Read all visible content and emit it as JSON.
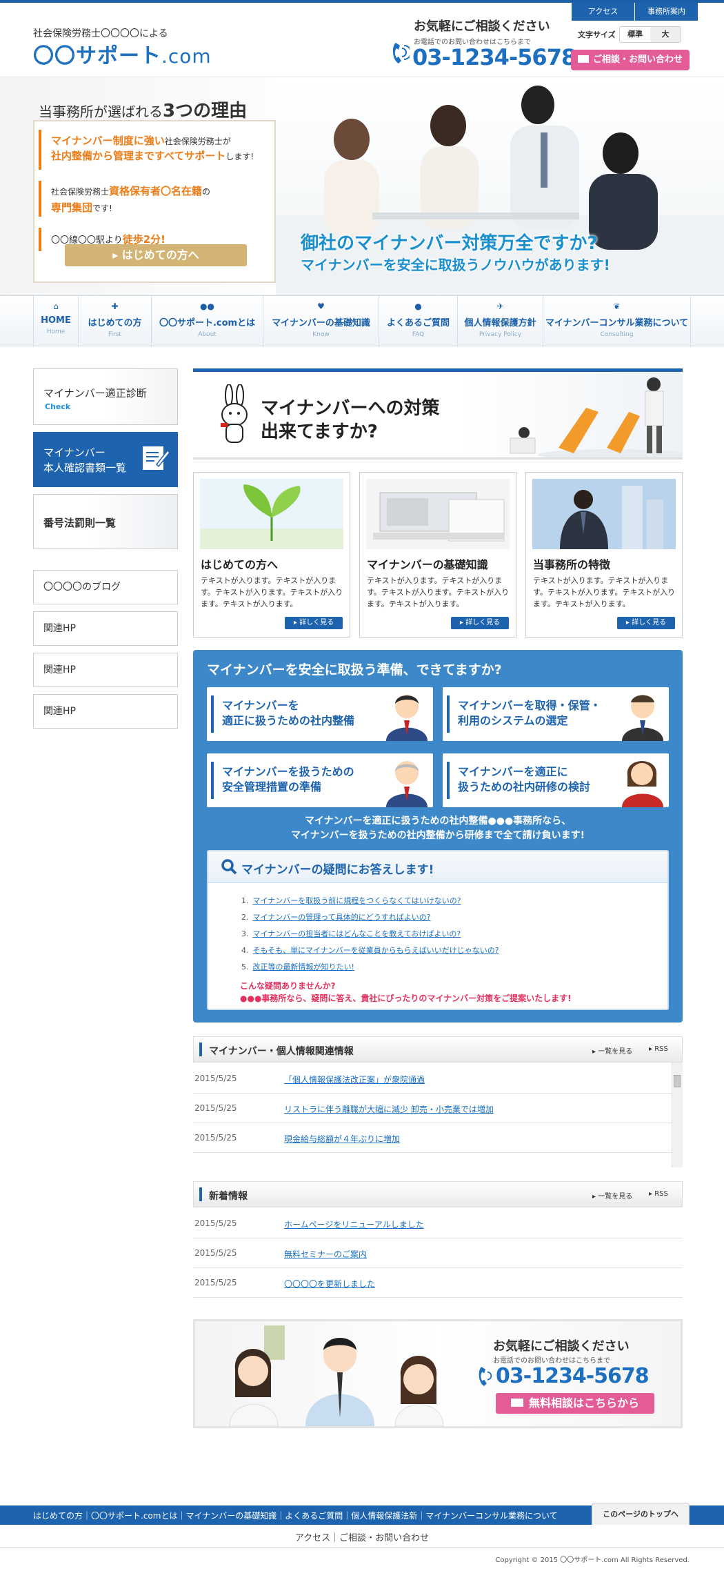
{
  "header": {
    "logo_sub": "社会保険労務士〇〇〇〇による",
    "logo_main": "〇〇サポート",
    "logo_com": ".com",
    "tel_label": "お気軽にご相談ください",
    "tel_sub": "お電話でのお問い合わせはこちらまで",
    "tel_number": "03-1234-5678",
    "top_links": [
      "アクセス",
      "事務所案内"
    ],
    "font_size_label": "文字サイズ",
    "font_size_options": [
      "標準",
      "大"
    ],
    "consult_button": "ご相談・お問い合わせ"
  },
  "hero": {
    "title_pre": "当事務所が選ばれる",
    "title_strong": "3つの理由",
    "reason1_a": "マイナンバー制度に強い",
    "reason1_b": "社会保険労務士が",
    "reason1_c": "社内整備から管理まですべてサポート",
    "reason1_d": "します!",
    "reason2_a": "社会保険労務士",
    "reason2_b": "資格保有者〇名在籍",
    "reason2_c": "の",
    "reason2_d": "専門集団",
    "reason2_e": "です!",
    "reason3_a": "〇〇線〇〇駅より",
    "reason3_b": "徒歩2分!",
    "first_button": "はじめての方へ",
    "catch1": "御社のマイナンバー対策万全ですか?",
    "catch2": "マイナンバーを安全に取扱うノウハウがあります!"
  },
  "nav": [
    {
      "jp": "HOME",
      "en": "Home",
      "icon": "home-icon"
    },
    {
      "jp": "はじめての方",
      "en": "First",
      "icon": "sparkle-icon"
    },
    {
      "jp": "〇〇サポート.comとは",
      "en": "About",
      "icon": "people-icon"
    },
    {
      "jp": "マイナンバーの基礎知識",
      "en": "Know",
      "icon": "heart-icon"
    },
    {
      "jp": "よくあるご質問",
      "en": "FAQ",
      "icon": "speech-icon"
    },
    {
      "jp": "個人情報保護方針",
      "en": "Privacy Policy",
      "icon": "bird-icon"
    },
    {
      "jp": "マイナンバーコンサル業務について",
      "en": "Consulting",
      "icon": "leaf-icon"
    }
  ],
  "sidebar": {
    "banner1_title": "マイナンバー適正診断",
    "banner1_sub": "Check",
    "banner2_line1": "マイナンバー",
    "banner2_line2": "本人確認書類一覧",
    "banner3_title": "番号法罰則一覧",
    "links": [
      "〇〇〇〇のブログ",
      "関連HP",
      "関連HP",
      "関連HP"
    ]
  },
  "main_banner": {
    "line1": "マイナンバーへの対策",
    "line2": "出来てますか?"
  },
  "features": [
    {
      "title": "はじめての方へ",
      "text": "テキストが入ります。テキストが入ります。テキストが入ります。テキストが入ります。テキストが入ります。",
      "more": "詳しく見る"
    },
    {
      "title": "マイナンバーの基礎知識",
      "text": "テキストが入ります。テキストが入ります。テキストが入ります。テキストが入ります。テキストが入ります。",
      "more": "詳しく見る"
    },
    {
      "title": "当事務所の特徴",
      "text": "テキストが入ります。テキストが入ります。テキストが入ります。テキストが入ります。テキストが入ります。",
      "more": "詳しく見る"
    }
  ],
  "prep": {
    "title": "マイナンバーを安全に取扱う準備、できてますか?",
    "cards": [
      {
        "line1": "マイナンバーを",
        "line2": "適正に扱うための社内整備"
      },
      {
        "line1": "マイナンバーを取得・保管・",
        "line2": "利用のシステムの選定"
      },
      {
        "line1": "マイナンバーを扱うための",
        "line2": "安全管理措置の準備"
      },
      {
        "line1": "マイナンバーを適正に",
        "line2": "扱うための社内研修の検討"
      }
    ],
    "msg1": "マイナンバーを適正に扱うための社内整備●●●事務所なら、",
    "msg2": "マイナンバーを扱うための社内整備から研修まで全て請け負います!",
    "qa_title": "マイナンバーの疑問にお答えします!",
    "qa_items": [
      "マイナンバーを取扱う前に規程をつくらなくてはいけないの?",
      "マイナンバーの管理って具体的にどうすればよいの?",
      "マイナンバーの担当者にはどんなことを教えておけばよいの?",
      "そもそも、単にマイナンバーを従業員からもらえばいいだけじゃないの?",
      "改正等の最新情報が知りたい!"
    ],
    "qa_pink1": "こんな疑問ありませんか?",
    "qa_pink2": "●●●事務所なら、疑問に答え、貴社にぴったりのマイナンバー対策をご提案いたします!"
  },
  "news1": {
    "title": "マイナンバー・個人情報関連情報",
    "list_link": "一覧を見る",
    "rss": "RSS",
    "rows": [
      {
        "date": "2015/5/25",
        "text": "「個人情報保護法改正案」が衆院通過"
      },
      {
        "date": "2015/5/25",
        "text": "リストラに伴う離職が大幅に減少 卸売・小売業では増加"
      },
      {
        "date": "2015/5/25",
        "text": "現金給与総額が４年ぶりに増加"
      }
    ]
  },
  "news2": {
    "title": "新着情報",
    "list_link": "一覧を見る",
    "rss": "RSS",
    "rows": [
      {
        "date": "2015/5/25",
        "text": "ホームページをリニューアルしました"
      },
      {
        "date": "2015/5/25",
        "text": "無料セミナーのご案内"
      },
      {
        "date": "2015/5/25",
        "text": "〇〇〇〇を更新しました"
      }
    ]
  },
  "contact_banner": {
    "label": "お気軽にご相談ください",
    "sub": "お電話でのお問い合わせはこちらまで",
    "tel": "03-1234-5678",
    "button": "無料相談はこちらから"
  },
  "footer": {
    "links": "はじめての方｜〇〇サポート.comとは｜マイナンバーの基礎知識｜よくあるご質問｜個人情報保護法新｜マイナンバーコンサル業務について",
    "pagetop": "このページのトップへ",
    "sub_links": "アクセス｜ご相談・お問い合わせ",
    "copyright": "Copyright © 2015 〇〇サポート.com All Rights Reserved."
  },
  "colors": {
    "brand_blue": "#1d63ad",
    "accent_orange": "#ee7d18",
    "pink": "#e45c97",
    "panel_blue": "#3d88c8"
  }
}
